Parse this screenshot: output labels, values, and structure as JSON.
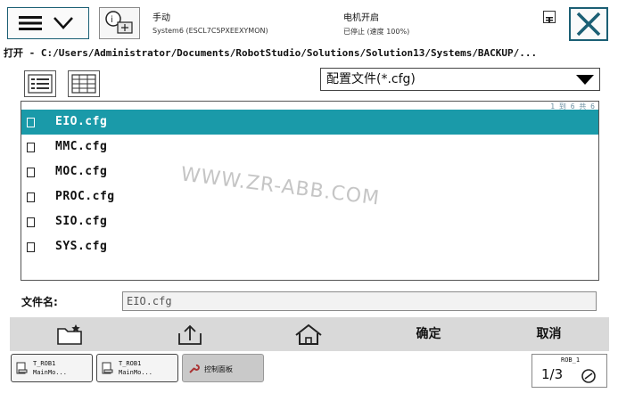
{
  "header": {
    "mode": "手动",
    "system_name": "System6 (ESCL7C5PXEEXYMON)",
    "motor_state": "电机开启",
    "run_state": "已停止 (速度 100%)"
  },
  "path": "打开 - C:/Users/Administrator/Documents/RobotStudio/Solutions/Solution13/Systems/BACKUP/...",
  "filter": {
    "selected": "配置文件(*.cfg)"
  },
  "list": {
    "counter": "1 到 6 共 6",
    "items": [
      {
        "name": "EIO.cfg",
        "selected": true
      },
      {
        "name": "MMC.cfg",
        "selected": false
      },
      {
        "name": "MOC.cfg",
        "selected": false
      },
      {
        "name": "PROC.cfg",
        "selected": false
      },
      {
        "name": "SIO.cfg",
        "selected": false
      },
      {
        "name": "SYS.cfg",
        "selected": false
      }
    ]
  },
  "filename": {
    "label": "文件名:",
    "value": "EIO.cfg"
  },
  "commands": {
    "new_folder_icon": "new-folder-icon",
    "up_folder_icon": "up-folder-icon",
    "home_icon": "home-icon",
    "ok": "确定",
    "cancel": "取消"
  },
  "taskbar": {
    "tasks": [
      {
        "line1": "T_ROB1",
        "line2": "MainMo..."
      },
      {
        "line1": "T_ROB1",
        "line2": "MainMo..."
      },
      {
        "line1": "控制面板",
        "line2": ""
      }
    ],
    "quickset_label": "ROB_1",
    "quickset_fraction": "1/3"
  },
  "watermark": "WWW.ZR-ABB.COM",
  "colors": {
    "selection": "#1a9aa9",
    "accent": "#1b5f74",
    "command_bar": "#d9d9d9"
  }
}
